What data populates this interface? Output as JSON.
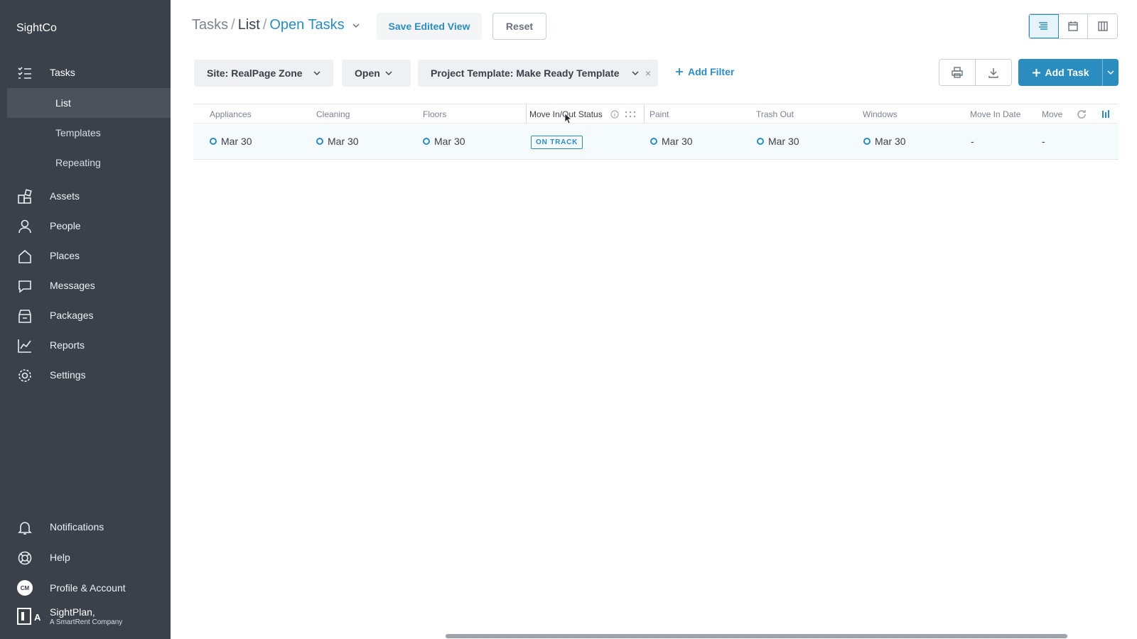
{
  "brand": "SightCo",
  "nav": {
    "tasks": "Tasks",
    "sub": [
      "List",
      "Templates",
      "Repeating"
    ],
    "assets": "Assets",
    "people": "People",
    "places": "Places",
    "messages": "Messages",
    "packages": "Packages",
    "reports": "Reports",
    "settings": "Settings",
    "notifications": "Notifications",
    "help": "Help",
    "profile": "Profile & Account",
    "profile_initials": "CM"
  },
  "company": {
    "logo_letter": "A",
    "name": "SightPlan,",
    "tagline": "A SmartRent Company"
  },
  "breadcrumb": {
    "root": "Tasks",
    "sep1": "/",
    "list": "List",
    "sep2": "/",
    "view": "Open Tasks"
  },
  "header": {
    "save_view": "Save Edited View",
    "reset": "Reset"
  },
  "filters": {
    "site": "Site: RealPage Zone",
    "status": "Open",
    "template": "Project Template: Make Ready Template",
    "remove": "×",
    "add_filter": "Add Filter"
  },
  "actions": {
    "add_task": "Add Task"
  },
  "table": {
    "columns": [
      "Appliances",
      "Cleaning",
      "Floors",
      "Move In/Out Status",
      "Paint",
      "Trash Out",
      "Windows",
      "Move In Date",
      "Move"
    ],
    "row": {
      "appliances": "Mar 30",
      "cleaning": "Mar 30",
      "floors": "Mar 30",
      "status": "ON TRACK",
      "paint": "Mar 30",
      "trash_out": "Mar 30",
      "windows": "Mar 30",
      "move_in_date": "-",
      "move": "-"
    }
  }
}
